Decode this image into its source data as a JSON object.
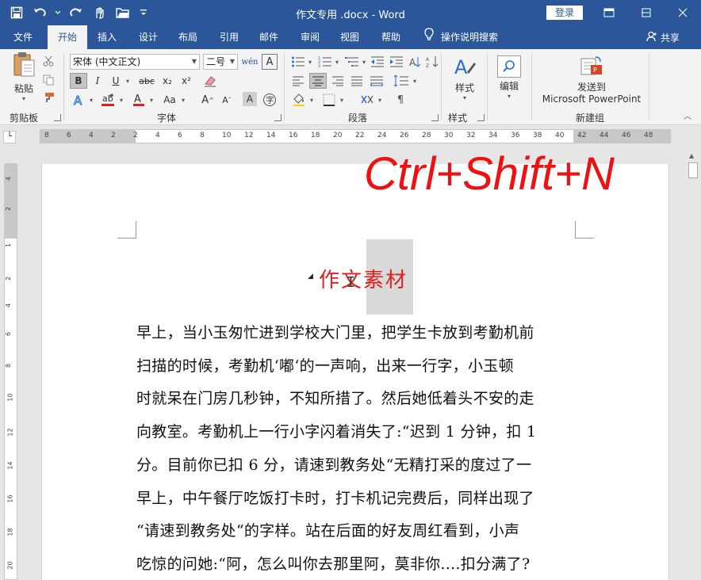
{
  "window": {
    "title": "作文专用 .docx  -  Word",
    "login_label": "登录",
    "minimize_icon": "minimize-icon",
    "restore_icon": "restore-icon",
    "close_icon": "close-icon"
  },
  "qat": {
    "items": [
      "save-icon",
      "undo-icon",
      "redo-icon",
      "touch-mode-icon",
      "open-folder-icon",
      "customize-qat-icon"
    ]
  },
  "tabs": [
    "文件",
    "开始",
    "插入",
    "设计",
    "布局",
    "引用",
    "邮件",
    "审阅",
    "视图",
    "帮助"
  ],
  "active_tab": "开始",
  "tell_me": "操作说明搜索",
  "share": "共享",
  "ribbon": {
    "clipboard": {
      "paste": "粘贴",
      "label": "剪贴板"
    },
    "font": {
      "font_name": "宋体 (中文正文)",
      "font_size": "二号",
      "bold": "B",
      "italic": "I",
      "underline": "U",
      "strike": "abc",
      "subscript": "x₂",
      "superscript": "x²",
      "font_color": "A",
      "case": "Aa",
      "label": "字体"
    },
    "paragraph": {
      "label": "段落"
    },
    "styles": {
      "btn": "样式",
      "label": "样式"
    },
    "editing": {
      "btn": "编辑"
    },
    "new_group": {
      "btn_line1": "发送到",
      "btn_line2": "Microsoft PowerPoint",
      "label": "新建组"
    }
  },
  "ruler": {
    "h_numbers": [
      "8",
      "6",
      "4",
      "2",
      "2",
      "4",
      "6",
      "8",
      "10",
      "12",
      "14",
      "16",
      "18",
      "20",
      "22",
      "24",
      "26",
      "28",
      "30",
      "32",
      "34",
      "36",
      "38",
      "40",
      "42",
      "44",
      "46",
      "48"
    ],
    "v_numbers": [
      "4",
      "2",
      "1",
      "2",
      "4",
      "6",
      "8",
      "10",
      "12",
      "14",
      "16",
      "18",
      "20"
    ]
  },
  "overlay": {
    "shortcut": "Ctrl+Shift+N"
  },
  "document": {
    "heading": "作文素材",
    "lines": [
      "早上，当小玉匆忙进到学校大门里，把学生卡放到考勤机前",
      "扫描的时候，考勤机‘嘟‘的一声响，出来一行字，小玉顿",
      "时就呆在门房几秒钟，不知所措了。然后她低着头不安的走",
      "向教室。考勤机上一行小字闪着消失了:“迟到 1 分钟，扣 1",
      "分。目前你已扣 6 分，请速到教务处“无精打采的度过了一",
      "早上，中午餐厅吃饭打卡时，打卡机记完费后，同样出现了",
      "“请速到教务处“的字样。站在后面的好友周红看到，小声",
      "吃惊的问她:“阿，怎么叫你去那里阿，莫非你....扣分满了?"
    ]
  },
  "colors": {
    "brand": "#2b579a",
    "heading_red": "#e02020",
    "shortcut_red": "#ee1111"
  }
}
